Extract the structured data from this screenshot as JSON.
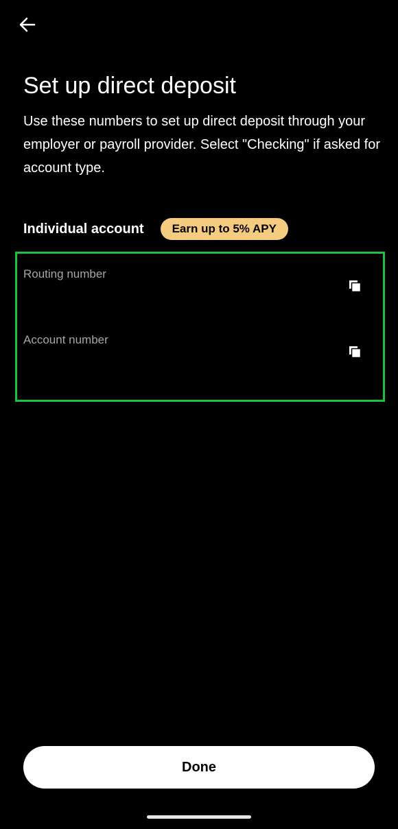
{
  "header": {
    "back_icon": "arrow-left-icon"
  },
  "page": {
    "title": "Set up direct deposit",
    "description": "Use these numbers to set up direct deposit through your employer or payroll provider. Select \"Checking\" if asked for account type."
  },
  "account": {
    "type_label": "Individual account",
    "badge": "Earn up to 5% APY",
    "badge_color": "#f5cc7f"
  },
  "numbers": {
    "highlight_color": "#19c33c",
    "routing_label": "Routing number",
    "account_label": "Account number",
    "copy_icon": "copy-icon"
  },
  "footer": {
    "done_label": "Done"
  }
}
